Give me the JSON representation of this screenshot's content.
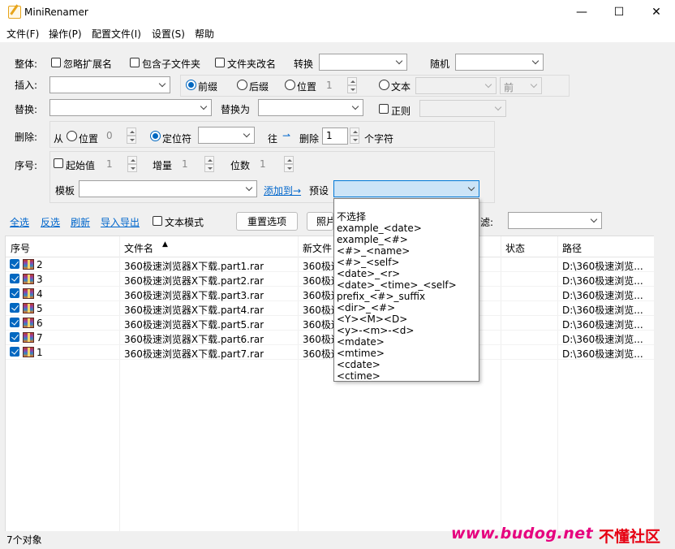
{
  "window": {
    "title": "MiniRenamer",
    "minimize": "—",
    "maximize": "☐",
    "close": "✕"
  },
  "menu": [
    "文件(F)",
    "操作(P)",
    "配置文件(I)",
    "设置(S)",
    "帮助"
  ],
  "whole": {
    "label": "整体:",
    "ignore_ext": "忽略扩展名",
    "include_subfolders": "包含子文件夹",
    "folder_rename": "文件夹改名",
    "convert_label": "转换",
    "random_label": "随机"
  },
  "insert": {
    "label": "插入:",
    "prefix": "前缀",
    "suffix": "后缀",
    "position": "位置",
    "position_value": "1",
    "text": "文本",
    "dir_value": "前"
  },
  "replace": {
    "label": "替换:",
    "replace_with": "替换为",
    "regex": "正则"
  },
  "delete": {
    "label": "删除:",
    "from": "从",
    "position": "位置",
    "position_value": "0",
    "locator": "定位符",
    "to": "往",
    "arrow": "⇀",
    "delete": "删除",
    "count_value": "1",
    "chars": "个字符"
  },
  "sequence": {
    "label": "序号:",
    "start": "起始值",
    "start_value": "1",
    "increment": "增量",
    "increment_value": "1",
    "digits": "位数",
    "digits_value": "1",
    "template": "模板",
    "add_to": "添加到→",
    "preset": "预设"
  },
  "toolbar": {
    "select_all": "全选",
    "invert": "反选",
    "refresh": "刷新",
    "import_export": "导入导出",
    "text_mode": "文本模式",
    "reset": "重置选项",
    "photo": "照片",
    "filter": "滤:"
  },
  "columns": {
    "seq": "序号",
    "filename": "文件名",
    "sort_arrow": "▲",
    "newname": "新文件",
    "status": "状态",
    "path": "路径"
  },
  "rows": [
    {
      "seq": "2",
      "filename": "360极速浏览器X下载.part1.rar",
      "newname": "360极速",
      "path": "D:\\360极速浏览..."
    },
    {
      "seq": "3",
      "filename": "360极速浏览器X下载.part2.rar",
      "newname": "360极速",
      "path": "D:\\360极速浏览..."
    },
    {
      "seq": "4",
      "filename": "360极速浏览器X下载.part3.rar",
      "newname": "360极速",
      "path": "D:\\360极速浏览..."
    },
    {
      "seq": "5",
      "filename": "360极速浏览器X下载.part4.rar",
      "newname": "360极速",
      "path": "D:\\360极速浏览..."
    },
    {
      "seq": "6",
      "filename": "360极速浏览器X下载.part5.rar",
      "newname": "360极速",
      "path": "D:\\360极速浏览..."
    },
    {
      "seq": "7",
      "filename": "360极速浏览器X下载.part6.rar",
      "newname": "360极速",
      "path": "D:\\360极速浏览..."
    },
    {
      "seq": "1",
      "filename": "360极速浏览器X下载.part7.rar",
      "newname": "360极速",
      "path": "D:\\360极速浏览..."
    }
  ],
  "preset_options": [
    "不选择",
    "example_<date>",
    "example_<#>",
    "<#>_<name>",
    "<#>_<self>",
    "<date>_<r>",
    "<date>_<time>_<self>",
    "prefix_<#>_suffix",
    "<dir>_<#>",
    "<Y><M><D>",
    "<y>-<m>-<d>",
    "<mdate>",
    "<mtime>",
    "<cdate>",
    "<ctime>"
  ],
  "status": "7个对象",
  "watermark": {
    "site": "www.budog.net",
    "name": "不懂社区"
  },
  "colors": {
    "accent": "#0067c0",
    "link": "#0066cc",
    "watermark": "#e6007e"
  }
}
